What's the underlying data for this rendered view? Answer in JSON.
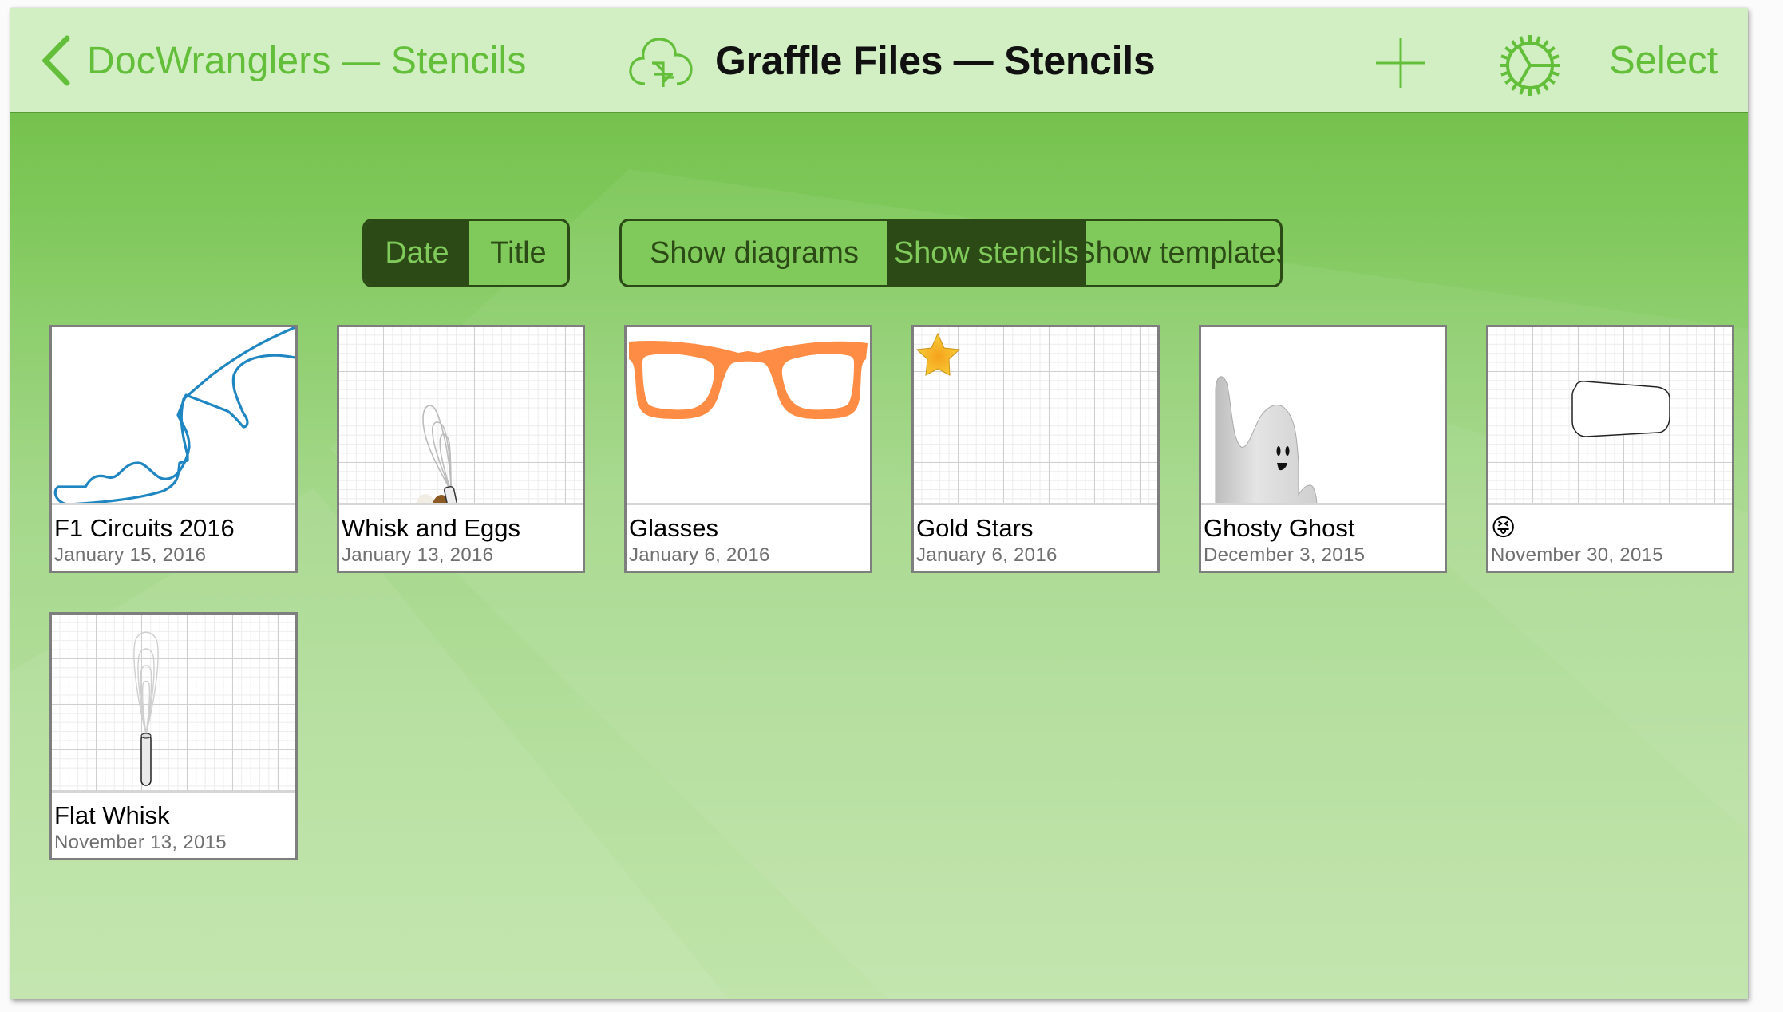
{
  "header": {
    "back_label": "DocWranglers — Stencils",
    "title": "Graffle Files — Stencils",
    "sync_icon": "cloud-sync-icon",
    "add_icon": "plus-icon",
    "settings_icon": "gear-icon",
    "select_label": "Select"
  },
  "sort_control": {
    "segments": [
      {
        "label": "Date",
        "selected": true
      },
      {
        "label": "Title",
        "selected": false
      }
    ]
  },
  "filter_control": {
    "segments": [
      {
        "label": "Show diagrams",
        "selected": false
      },
      {
        "label": "Show stencils",
        "selected": true
      },
      {
        "label": "Show templates",
        "selected": false
      }
    ]
  },
  "documents": [
    {
      "title": "F1 Circuits 2016",
      "date": "January 15, 2016",
      "thumbnail": "race-circuit-outline"
    },
    {
      "title": "Whisk and Eggs",
      "date": "January 13, 2016",
      "thumbnail": "whisk-and-eggs"
    },
    {
      "title": "Glasses",
      "date": "January 6, 2016",
      "thumbnail": "orange-glasses"
    },
    {
      "title": "Gold Stars",
      "date": "January 6, 2016",
      "thumbnail": "gold-star"
    },
    {
      "title": "Ghosty Ghost",
      "date": "December 3, 2015",
      "thumbnail": "ghost"
    },
    {
      "title": "😝",
      "date": "November 30, 2015",
      "thumbnail": "rounded-trapezoid"
    },
    {
      "title": "Flat Whisk",
      "date": "November 13, 2015",
      "thumbnail": "flat-whisk"
    }
  ],
  "colors": {
    "accent": "#63bf3a",
    "header_bg": "#d2efc4",
    "segment_dark": "#2b4a15",
    "segment_light": "#7fca5a",
    "circuit_line": "#1f86c2",
    "glasses": "#ff8c44",
    "star": "#f5b921"
  }
}
